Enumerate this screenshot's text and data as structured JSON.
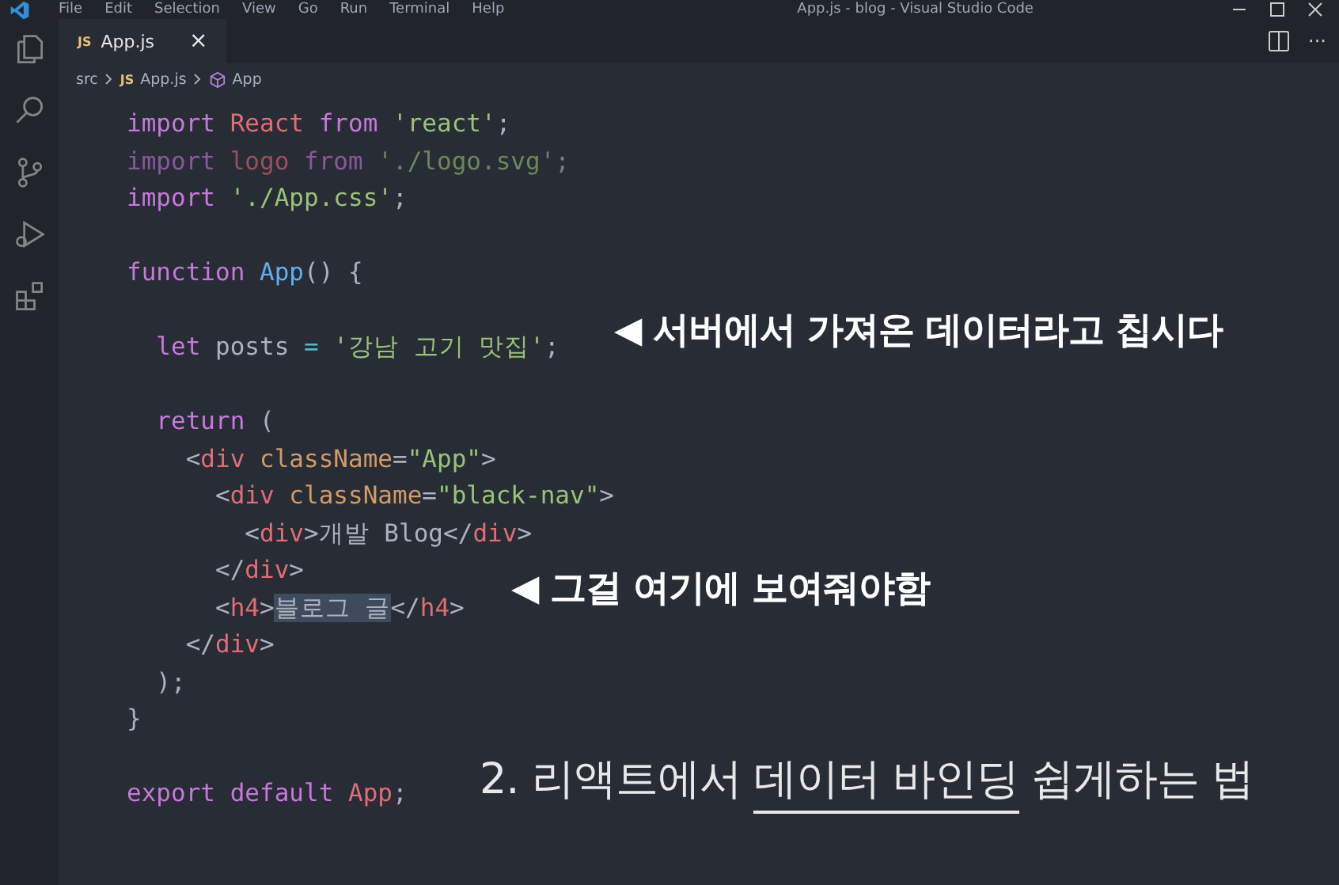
{
  "window": {
    "title": "App.js - blog - Visual Studio Code",
    "menu": [
      "File",
      "Edit",
      "Selection",
      "View",
      "Go",
      "Run",
      "Terminal",
      "Help"
    ]
  },
  "tab": {
    "badge": "JS",
    "label": "App.js",
    "close": "×",
    "selected": true
  },
  "editor_actions": {
    "more": "···"
  },
  "breadcrumbs": [
    {
      "kind": "folder",
      "label": "src"
    },
    {
      "kind": "file",
      "badge": "JS",
      "label": "App.js"
    },
    {
      "kind": "symbol",
      "label": "App"
    }
  ],
  "code": [
    {
      "kind": "code",
      "tokens": [
        {
          "text": "import",
          "kind": "keyword"
        },
        {
          "text": " React",
          "kind": "name"
        },
        {
          "text": " from",
          "kind": "keyword"
        },
        {
          "text": " 'react'",
          "kind": "string"
        },
        {
          "text": ";",
          "kind": "punct"
        }
      ]
    },
    {
      "kind": "dimmed",
      "tokens": [
        {
          "text": "import",
          "kind": "keyword"
        },
        {
          "text": " logo",
          "kind": "name"
        },
        {
          "text": " from",
          "kind": "keyword"
        },
        {
          "text": " './logo.svg'",
          "kind": "string"
        },
        {
          "text": ";",
          "kind": "punct"
        }
      ]
    },
    {
      "kind": "code",
      "tokens": [
        {
          "text": "import",
          "kind": "keyword"
        },
        {
          "text": " './App.css'",
          "kind": "string"
        },
        {
          "text": ";",
          "kind": "punct"
        }
      ]
    },
    {
      "kind": "blank"
    },
    {
      "kind": "code",
      "tokens": [
        {
          "text": "function",
          "kind": "keyword"
        },
        {
          "text": " App",
          "kind": "function"
        },
        {
          "text": "() {",
          "kind": "punct"
        }
      ]
    },
    {
      "kind": "blank"
    },
    {
      "kind": "code",
      "tokens": [
        {
          "text": "  let",
          "kind": "keyword"
        },
        {
          "text": " posts",
          "kind": "plain"
        },
        {
          "text": " =",
          "kind": "operator"
        },
        {
          "text": " '강남 고기 맛집'",
          "kind": "string"
        },
        {
          "text": ";",
          "kind": "punct"
        }
      ]
    },
    {
      "kind": "blank"
    },
    {
      "kind": "code",
      "tokens": [
        {
          "text": "  return",
          "kind": "keyword"
        },
        {
          "text": " (",
          "kind": "punct"
        }
      ]
    },
    {
      "kind": "code",
      "tokens": [
        {
          "text": "    <",
          "kind": "punct"
        },
        {
          "text": "div",
          "kind": "tag"
        },
        {
          "text": " className",
          "kind": "attr"
        },
        {
          "text": "=",
          "kind": "punct"
        },
        {
          "text": "\"App\"",
          "kind": "string"
        },
        {
          "text": ">",
          "kind": "punct"
        }
      ]
    },
    {
      "kind": "code",
      "tokens": [
        {
          "text": "      <",
          "kind": "punct"
        },
        {
          "text": "div",
          "kind": "tag"
        },
        {
          "text": " className",
          "kind": "attr"
        },
        {
          "text": "=",
          "kind": "punct"
        },
        {
          "text": "\"black-nav\"",
          "kind": "string"
        },
        {
          "text": ">",
          "kind": "punct"
        }
      ]
    },
    {
      "kind": "code",
      "tokens": [
        {
          "text": "        <",
          "kind": "punct"
        },
        {
          "text": "div",
          "kind": "tag"
        },
        {
          "text": ">",
          "kind": "punct"
        },
        {
          "text": "개발 Blog",
          "kind": "plain"
        },
        {
          "text": "</",
          "kind": "punct"
        },
        {
          "text": "div",
          "kind": "tag"
        },
        {
          "text": ">",
          "kind": "punct"
        }
      ]
    },
    {
      "kind": "code",
      "tokens": [
        {
          "text": "      </",
          "kind": "punct"
        },
        {
          "text": "div",
          "kind": "tag"
        },
        {
          "text": ">",
          "kind": "punct"
        }
      ]
    },
    {
      "kind": "code",
      "tokens": [
        {
          "text": "      <",
          "kind": "punct"
        },
        {
          "text": "h4",
          "kind": "tag"
        },
        {
          "text": ">",
          "kind": "punct"
        },
        {
          "text": "블로그 글",
          "kind": "selection"
        },
        {
          "text": "</",
          "kind": "punct"
        },
        {
          "text": "h4",
          "kind": "tag"
        },
        {
          "text": ">",
          "kind": "punct"
        }
      ]
    },
    {
      "kind": "code",
      "tokens": [
        {
          "text": "    </",
          "kind": "punct"
        },
        {
          "text": "div",
          "kind": "tag"
        },
        {
          "text": ">",
          "kind": "punct"
        }
      ]
    },
    {
      "kind": "code",
      "tokens": [
        {
          "text": "  );",
          "kind": "punct"
        }
      ]
    },
    {
      "kind": "code",
      "tokens": [
        {
          "text": "}",
          "kind": "punct"
        }
      ]
    },
    {
      "kind": "blank"
    },
    {
      "kind": "code",
      "tokens": [
        {
          "text": "export",
          "kind": "keyword"
        },
        {
          "text": " default",
          "kind": "keyword"
        },
        {
          "text": " App",
          "kind": "name"
        },
        {
          "text": ";",
          "kind": "punct"
        }
      ]
    }
  ],
  "annotations": [
    {
      "arrow": "◀",
      "text": "서버에서 가져온 데이터라고 칩시다"
    },
    {
      "arrow": "◀",
      "text": "그걸 여기에 보여줘야함"
    }
  ],
  "subtitle": [
    {
      "text": "2. 리액트에서 ",
      "underlined": false
    },
    {
      "text": "데이터 바인딩",
      "underlined": true
    },
    {
      "text": " 쉽게하는 법",
      "underlined": false
    }
  ]
}
